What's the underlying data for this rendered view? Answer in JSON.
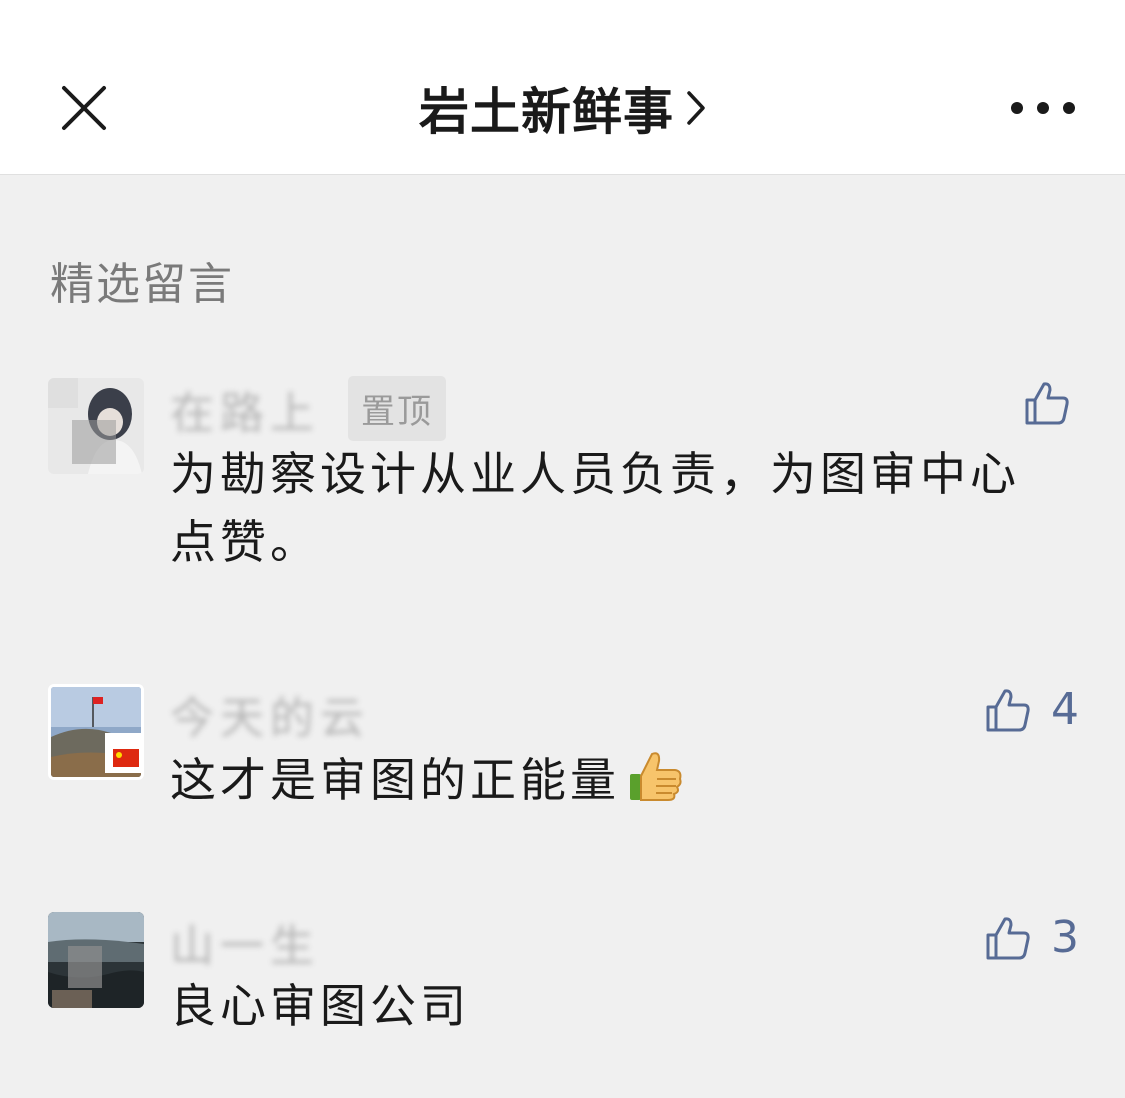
{
  "header": {
    "title": "岩土新鲜事",
    "close_icon": "close-icon",
    "chevron_icon": "chevron-right-icon",
    "more_icon": "more-dots-icon"
  },
  "section_title": "精选留言",
  "colors": {
    "link_blue": "#576b95",
    "background": "#f0f0f0",
    "header_bg": "#ffffff",
    "muted_text": "#7a7a7a"
  },
  "comments": [
    {
      "nickname": "在路上",
      "badge": "置顶",
      "text": "为勘察设计从业人员负责，为图审中心点赞。",
      "like_count": "",
      "like_icon": "thumbs-up-icon"
    },
    {
      "nickname": "今天的云",
      "badge": "",
      "text": "这才是审图的正能量",
      "like_count": "4",
      "like_icon": "thumbs-up-icon",
      "emoji": "thumbs-up-emoji"
    },
    {
      "nickname": "山一生",
      "badge": "",
      "text": "良心审图公司",
      "like_count": "3",
      "like_icon": "thumbs-up-icon"
    }
  ]
}
